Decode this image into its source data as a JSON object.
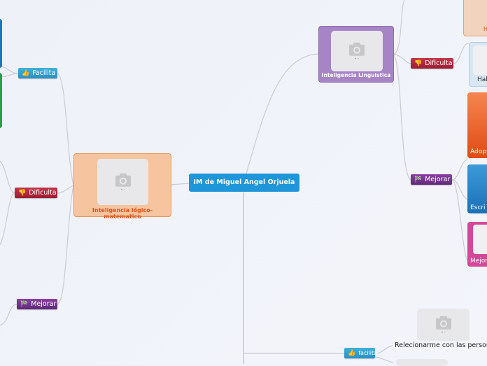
{
  "central": {
    "title": "IM de Miguel Angel Orjuela"
  },
  "nodes": {
    "logico": {
      "caption": "Inteligencia lógico-matematico"
    },
    "linguistica": {
      "caption": "Inteligencia Linguistica"
    }
  },
  "left_badges": {
    "facilita": "Facilita",
    "dificulta": "Dificulta",
    "mejorar": "Mejorar"
  },
  "right_badges": {
    "dificulta": "Dificulta",
    "mejorar": "Mejorar",
    "facilita": "facilita"
  },
  "right_partial": {
    "top": "H",
    "hab": "Hab",
    "adop": "Adop",
    "escri": "Escri",
    "mejor": "Mejor"
  },
  "bottom_item": {
    "text": "Relecionarme con las persona"
  },
  "colors": {
    "central": "#1e96d9",
    "logico_fill": "#f6c49e",
    "logico_text": "#e2531a",
    "linguistica_fill": "#a784c5",
    "badge_blue": "#2f9fcf",
    "badge_red": "#b12a40",
    "badge_purple": "#74338e"
  },
  "icons": {
    "photo": "camera-placeholder-icon",
    "facilita": "thumbs-up-icon",
    "dificulta": "thumbs-down-icon",
    "mejorar": "checkered-flag-icon"
  }
}
